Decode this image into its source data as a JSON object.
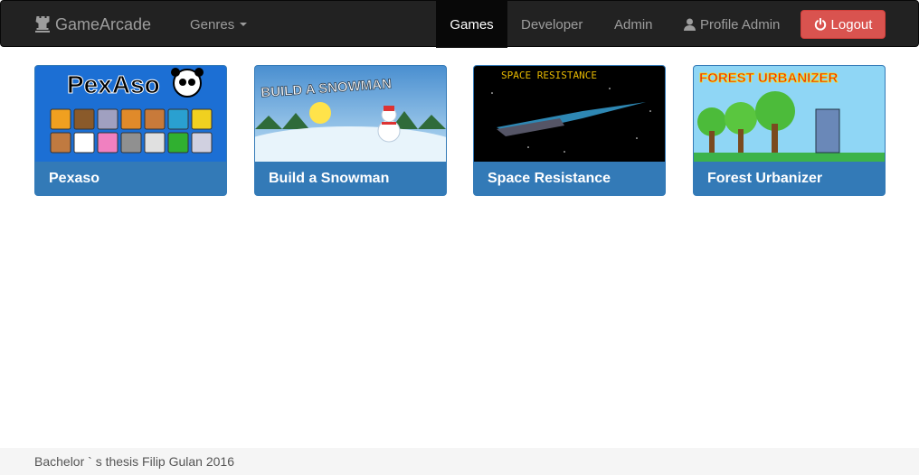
{
  "navbar": {
    "brand": "GameArcade",
    "genres": "Genres",
    "links": {
      "games": "Games",
      "developer": "Developer",
      "admin": "Admin",
      "profile": "Profile Admin",
      "logout": "Logout"
    }
  },
  "games": [
    {
      "title": "Pexaso",
      "banner": "PexAso"
    },
    {
      "title": "Build a Snowman",
      "banner": "BUILD A SNOWMAN"
    },
    {
      "title": "Space Resistance",
      "banner": "SPACE RESISTANCE"
    },
    {
      "title": "Forest Urbanizer",
      "banner": "FOREST URBANIZER"
    }
  ],
  "footer": {
    "text": "Bachelor ` s thesis Filip Gulan 2016"
  },
  "colors": {
    "navbar": "#222222",
    "primary": "#337ab7",
    "danger": "#d9534f",
    "footer": "#f5f5f5"
  }
}
